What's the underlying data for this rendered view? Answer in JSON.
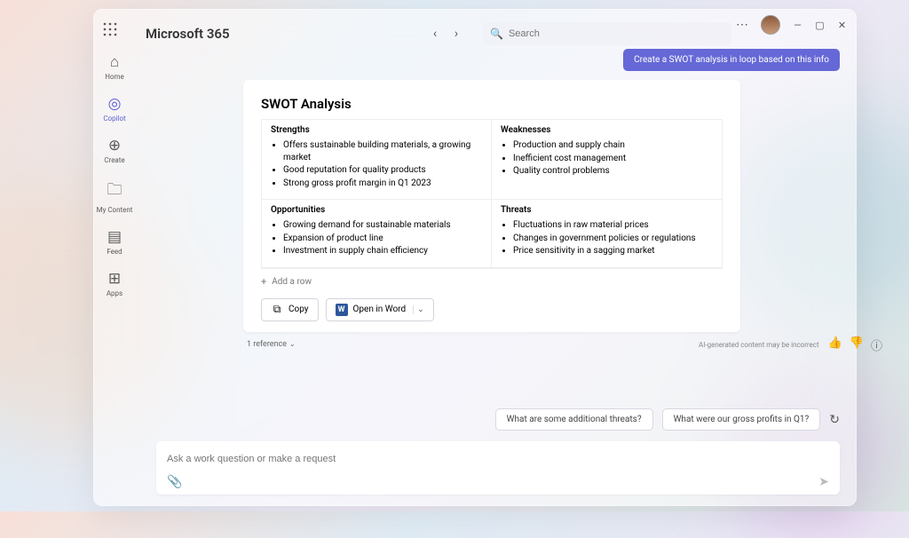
{
  "brand": "Microsoft 365",
  "search_placeholder": "Search",
  "sidebar": {
    "items": [
      {
        "label": "Home"
      },
      {
        "label": "Copilot"
      },
      {
        "label": "Create"
      },
      {
        "label": "My Content"
      },
      {
        "label": "Feed"
      },
      {
        "label": "Apps"
      }
    ]
  },
  "user_message": "Create a SWOT analysis in loop based on this info",
  "swot": {
    "title": "SWOT Analysis",
    "add_row": "Add a row",
    "strengths_h": "Strengths",
    "strengths": [
      "Offers sustainable building materials, a growing market",
      "Good reputation for quality products",
      "Strong gross profit margin in Q1 2023"
    ],
    "weaknesses_h": "Weaknesses",
    "weaknesses": [
      "Production and supply chain",
      "Inefficient cost management",
      "Quality control problems"
    ],
    "opportunities_h": "Opportunities",
    "opportunities": [
      "Growing demand for sustainable materials",
      "Expansion of product line",
      "Investment in supply chain efficiency"
    ],
    "threats_h": "Threats",
    "threats": [
      "Fluctuations in raw material prices",
      "Changes in government policies or regulations",
      "Price sensitivity in a sagging market"
    ]
  },
  "actions": {
    "copy": "Copy",
    "open_word": "Open in Word"
  },
  "reference": "1 reference",
  "disclaimer": "AI-generated content may be incorrect",
  "suggestions": [
    "What are some additional threats?",
    "What were our gross profits in Q1?"
  ],
  "compose_placeholder": "Ask a work question or make a request"
}
